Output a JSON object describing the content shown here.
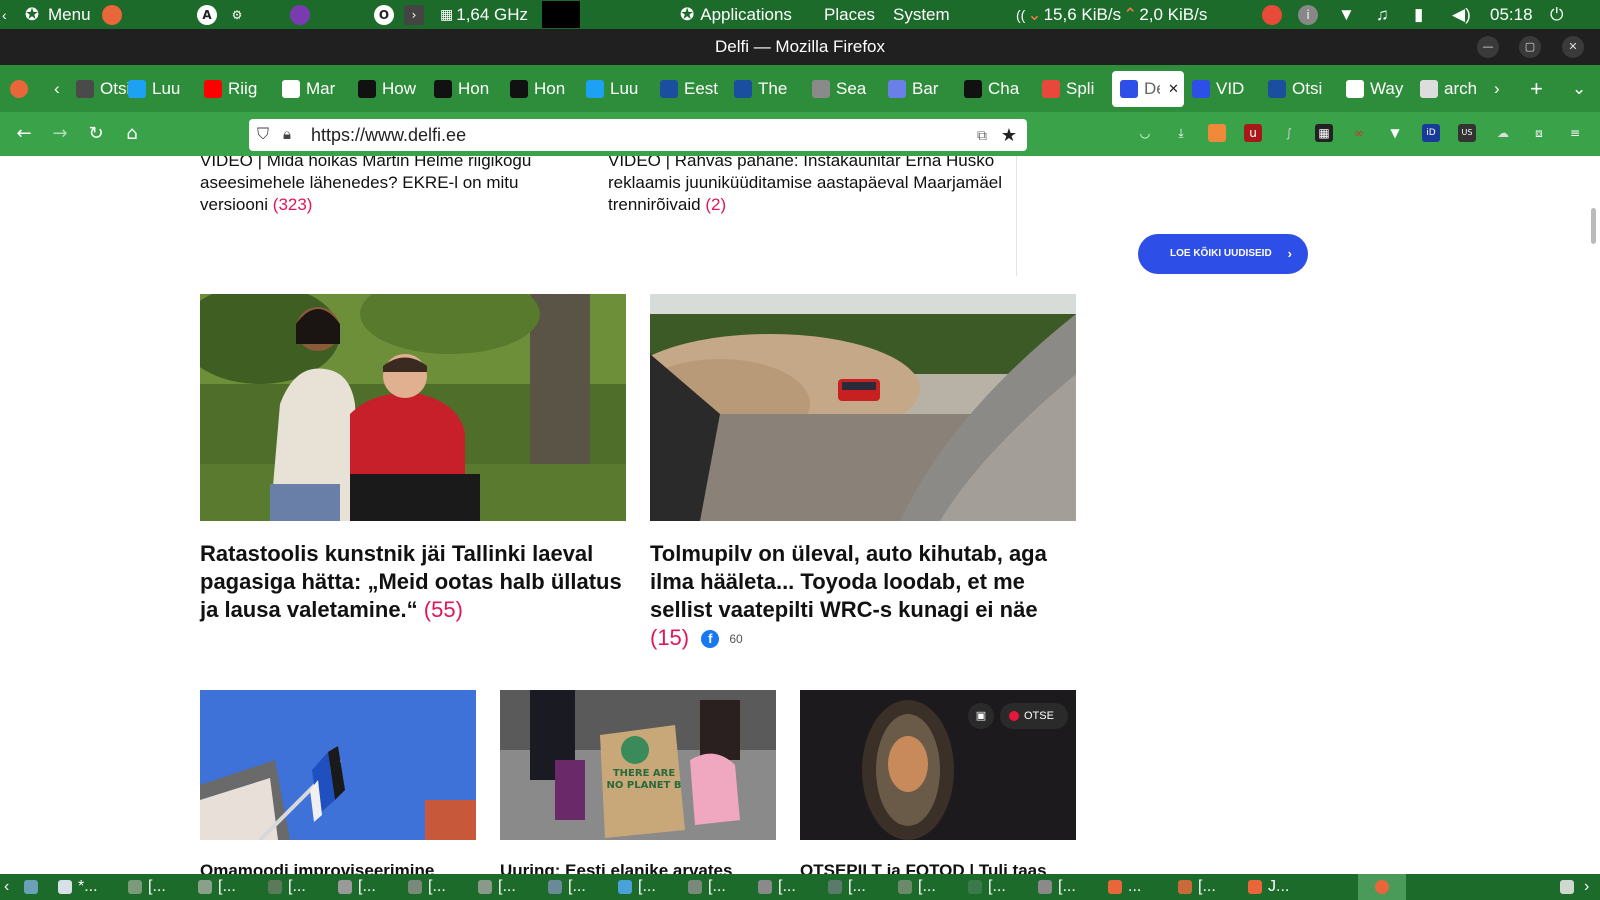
{
  "system_panel": {
    "menu_label": "Menu",
    "cpu_freq": "1,64 GHz",
    "applications": "Applications",
    "places": "Places",
    "system": "System",
    "net_down": "15,6 KiB/s",
    "net_up": "2,0 KiB/s",
    "clock": "05:18"
  },
  "window": {
    "title": "Delfi — Mozilla Firefox"
  },
  "tabs": [
    {
      "label": "Otsi",
      "icon": "tab-search-icon",
      "color": "#4a4a4a"
    },
    {
      "label": "Luu",
      "icon": "twitter-icon",
      "color": "#1da1f2"
    },
    {
      "label": "Riig",
      "icon": "youtube-icon",
      "color": "#ff0000"
    },
    {
      "label": "Mar",
      "icon": "wikipedia-icon",
      "color": "#ffffff"
    },
    {
      "label": "How",
      "icon": "r-icon",
      "color": "#111111"
    },
    {
      "label": "Hon",
      "icon": "r-icon",
      "color": "#111111"
    },
    {
      "label": "Hon",
      "icon": "r-icon",
      "color": "#111111"
    },
    {
      "label": "Luu",
      "icon": "twitter-icon",
      "color": "#1da1f2"
    },
    {
      "label": "Eest",
      "icon": "rt-icon",
      "color": "#1a4fa0"
    },
    {
      "label": "The",
      "icon": "rt-icon",
      "color": "#1a4fa0"
    },
    {
      "label": "Sea",
      "icon": "openai-icon",
      "color": "#8a8a8a"
    },
    {
      "label": "Bar",
      "icon": "bard-icon",
      "color": "#6a7fe8"
    },
    {
      "label": "Cha",
      "icon": "w-icon",
      "color": "#111111"
    },
    {
      "label": "Spli",
      "icon": "split-icon",
      "color": "#e8483c"
    },
    {
      "label": "De",
      "icon": "delfi-icon",
      "color": "#2d4fe8",
      "active": true
    },
    {
      "label": "VID",
      "icon": "delfi-icon",
      "color": "#2d4fe8"
    },
    {
      "label": "Otsi",
      "icon": "err-icon",
      "color": "#1a4fa0"
    },
    {
      "label": "Way",
      "icon": "archive-icon",
      "color": "#ffffff"
    },
    {
      "label": "arch",
      "icon": "doc-icon",
      "color": "#dddddd"
    }
  ],
  "navbar": {
    "url": "https://www.delfi.ee"
  },
  "page": {
    "top_left": {
      "text": "VIDEO | Mida hoikas Martin Helme riigikogu aseesimehele lähenedes? EKRE-l on mitu versiooni",
      "count": "(323)"
    },
    "top_right": {
      "text": "VIDEO | Rahvas pahane: Instakaunitar Erna Husko reklaamis juuniküüditamise aastapäeval Maarjamäel trennirõivaid",
      "count": "(2)"
    },
    "all_news_button": "LOE KÕIKI UUDISEID",
    "article1": {
      "title": "Ratastoolis kunstnik jäi Tallinki laeval pagasiga hätta: „Meid ootas halb üllatus ja lausa valetamine.“",
      "count": "(55)"
    },
    "article2": {
      "title": "Tolmupilv on üleval, auto kihutab, aga ilma hääleta... Toyoda loodab, et me sellist vaatepilti WRC-s kunagi ei näe",
      "count": "(15)",
      "fb_count": "60"
    },
    "article3": {
      "title": "Omamoodi improviseerimine"
    },
    "article4": {
      "title": "Uuring: Eesti elanike arvates",
      "sign_text": "THERE ARE NO PLANET B"
    },
    "article5": {
      "title": "OTSEPILT ja FOTOD | Tuli taas",
      "live_label": "OTSE"
    }
  },
  "taskbar": {
    "items": [
      "*...",
      "[...",
      "[...",
      "[...",
      "[...",
      "[...",
      "[...",
      "[...",
      "[...",
      "[...",
      "[...",
      "[...",
      "[...",
      "[...",
      "[...",
      "...",
      "[...",
      "J..."
    ]
  }
}
